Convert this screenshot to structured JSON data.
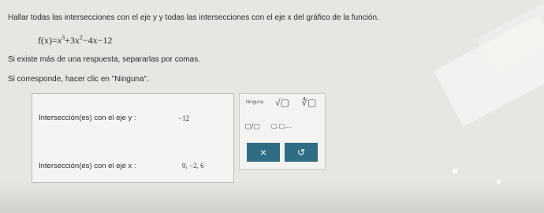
{
  "question": {
    "instruction": "Hallar todas las intersecciones con el eje y y todas las intersecciones con el eje x del gráfico de la función.",
    "formula": {
      "lhs": "f(x)",
      "eq": "=",
      "t1": "x",
      "t1_exp": "3",
      "t2": "+3x",
      "t2_exp": "2",
      "t3": "−4x−12"
    },
    "multiple_answers_note": "Si existe más de una respuesta, separarlas por comas.",
    "none_note": "Si corresponde, hacer clic en \"Ninguna\"."
  },
  "answers": {
    "y_label": "Intersección(es) con el eje y :",
    "y_value": "−12",
    "x_label": "Intersección(es) con el eje x :",
    "x_value": "0, −2, 6"
  },
  "palette": {
    "none_label": "Ninguna",
    "sqrt_label": "√▢",
    "nthroot_label": "∜▢",
    "fraction_label": "▢/▢",
    "list_label": "▢,▢,..."
  },
  "actions": {
    "clear_label": "×",
    "undo_label": "↺"
  }
}
